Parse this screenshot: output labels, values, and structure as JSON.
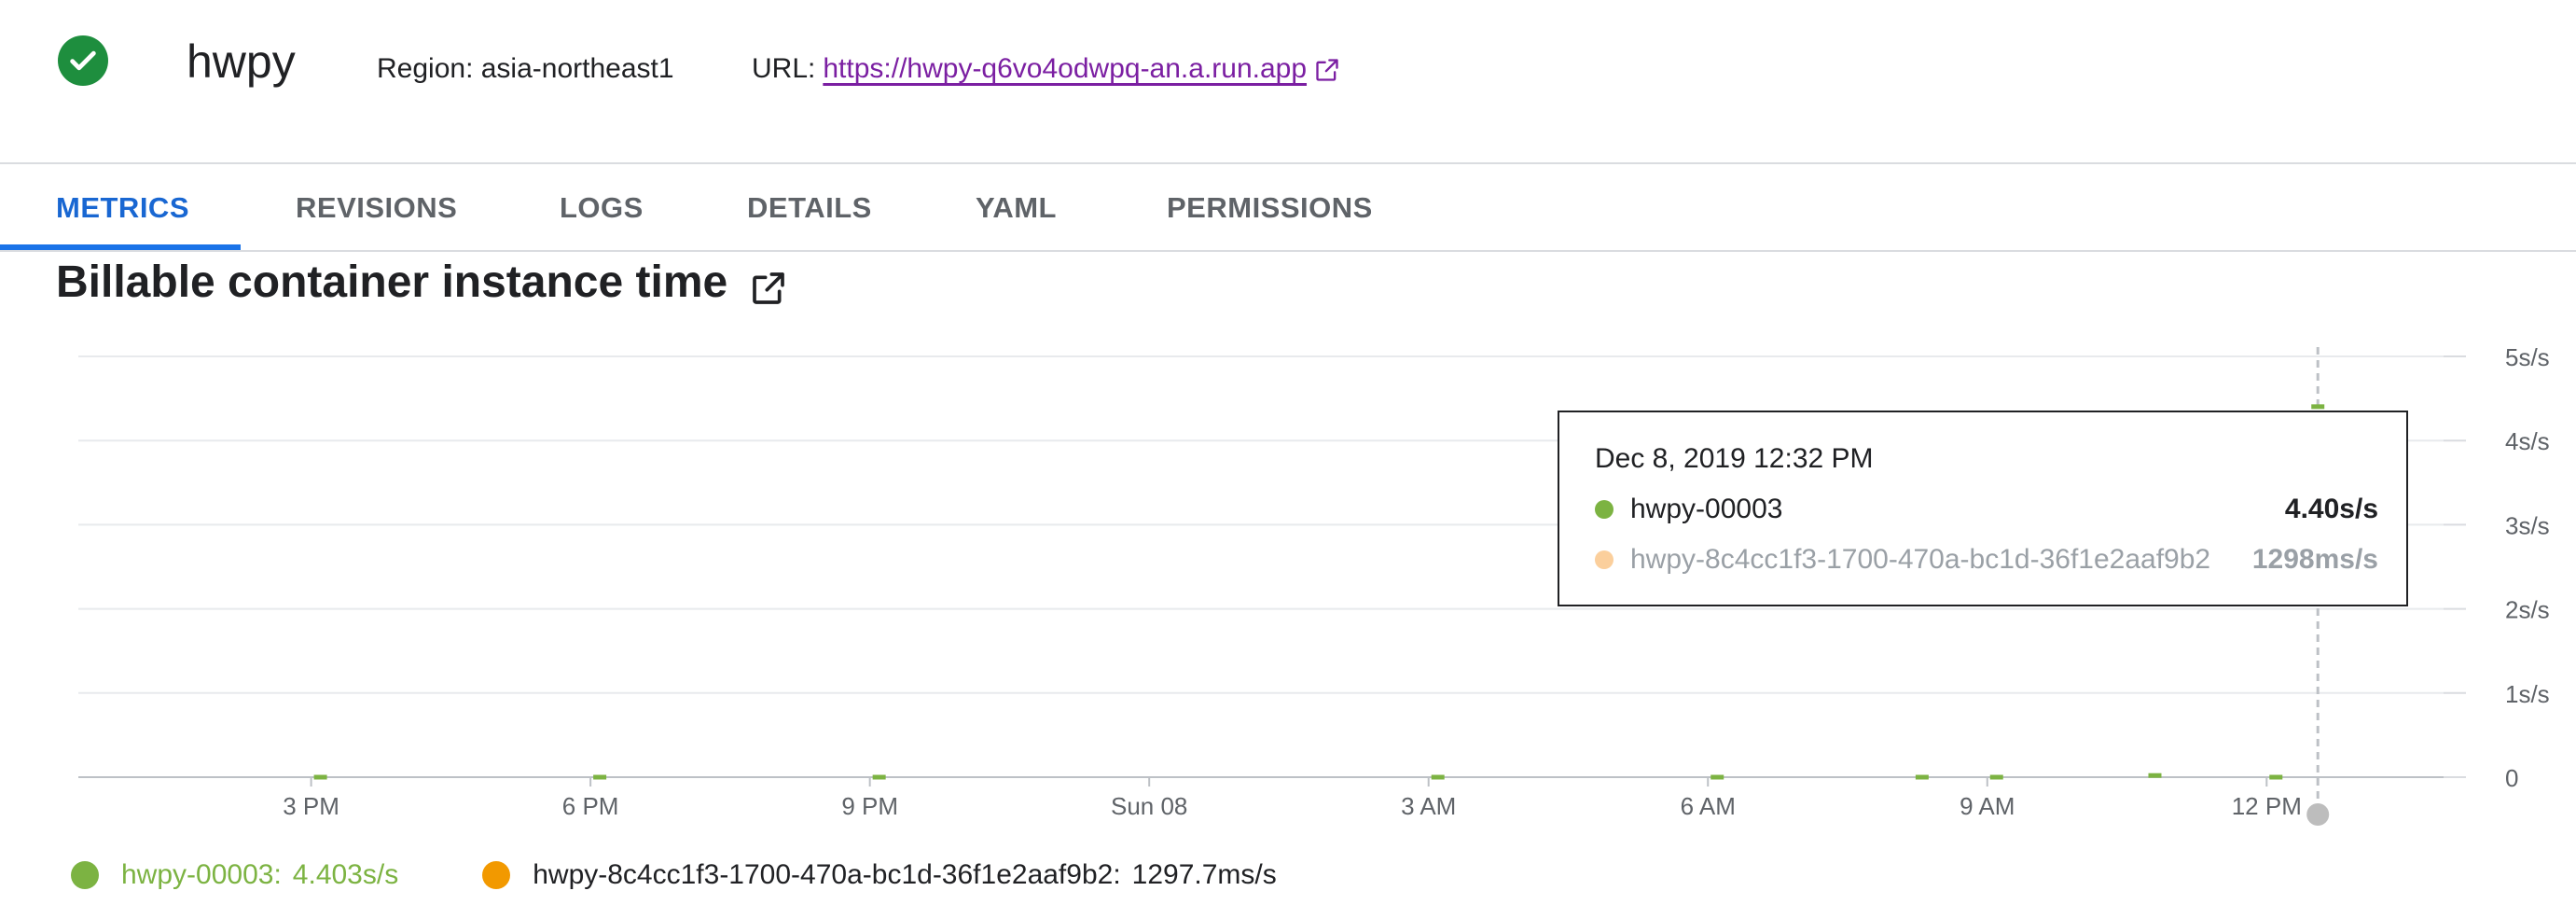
{
  "header": {
    "status_icon": "check-circle-icon",
    "status_color": "#1e8e3e",
    "service_name": "hwpy",
    "region_text": "Region: asia-northeast1",
    "url_label": "URL:",
    "url_value": "https://hwpy-q6vo4odwpq-an.a.run.app",
    "url_icon": "external-link-icon"
  },
  "tabs": [
    {
      "label": "METRICS",
      "active": true
    },
    {
      "label": "REVISIONS",
      "active": false
    },
    {
      "label": "LOGS",
      "active": false
    },
    {
      "label": "DETAILS",
      "active": false
    },
    {
      "label": "YAML",
      "active": false
    },
    {
      "label": "PERMISSIONS",
      "active": false
    }
  ],
  "colors": {
    "accent": "#1a73e8",
    "series_green": "#7cb342",
    "series_orange": "#f29900",
    "link_purple": "#7b1fa2"
  },
  "chart_data": {
    "type": "line",
    "title": "Billable container instance time",
    "title_icon": "external-link-icon",
    "x_ticks": [
      "3 PM",
      "6 PM",
      "9 PM",
      "Sun 08",
      "3 AM",
      "6 AM",
      "9 AM",
      "12 PM"
    ],
    "y_ticks": [
      "0",
      "1s/s",
      "2s/s",
      "3s/s",
      "4s/s",
      "5s/s"
    ],
    "ylim": [
      0,
      5
    ],
    "y_unit": "s/s",
    "grid": true,
    "x_hours_range": [
      12.5,
      37.9
    ],
    "series": [
      {
        "name": "hwpy-00003",
        "color": "#7cb342",
        "points": [
          {
            "t": 15.1,
            "v": 0.0
          },
          {
            "t": 18.1,
            "v": 0.0
          },
          {
            "t": 21.1,
            "v": 0.0
          },
          {
            "t": 27.1,
            "v": 0.0
          },
          {
            "t": 30.1,
            "v": 0.0
          },
          {
            "t": 32.3,
            "v": 0.0
          },
          {
            "t": 33.1,
            "v": 0.0
          },
          {
            "t": 34.8,
            "v": 0.02
          },
          {
            "t": 36.1,
            "v": 0.0
          },
          {
            "t": 36.55,
            "v": 4.403
          }
        ]
      },
      {
        "name": "hwpy-8c4cc1f3-1700-470a-bc1d-36f1e2aaf9b2",
        "color": "#f29900",
        "points": []
      }
    ],
    "cursor_hours": 36.55,
    "tooltip": {
      "date": "Dec 8, 2019 12:32 PM",
      "rows": [
        {
          "name": "hwpy-00003",
          "value": "4.40s/s",
          "color": "#7cb342",
          "faded": false
        },
        {
          "name": "hwpy-8c4cc1f3-1700-470a-bc1d-36f1e2aaf9b2",
          "value": "1298ms/s",
          "color": "#fbcf9c",
          "faded": true
        }
      ]
    },
    "legend": [
      {
        "name": "hwpy-00003:",
        "value": "4.403s/s",
        "color": "#7cb342",
        "label_color": "#7cb342"
      },
      {
        "name": "hwpy-8c4cc1f3-1700-470a-bc1d-36f1e2aaf9b2:",
        "value": "1297.7ms/s",
        "color": "#f29900",
        "label_color": "#202124"
      }
    ]
  }
}
